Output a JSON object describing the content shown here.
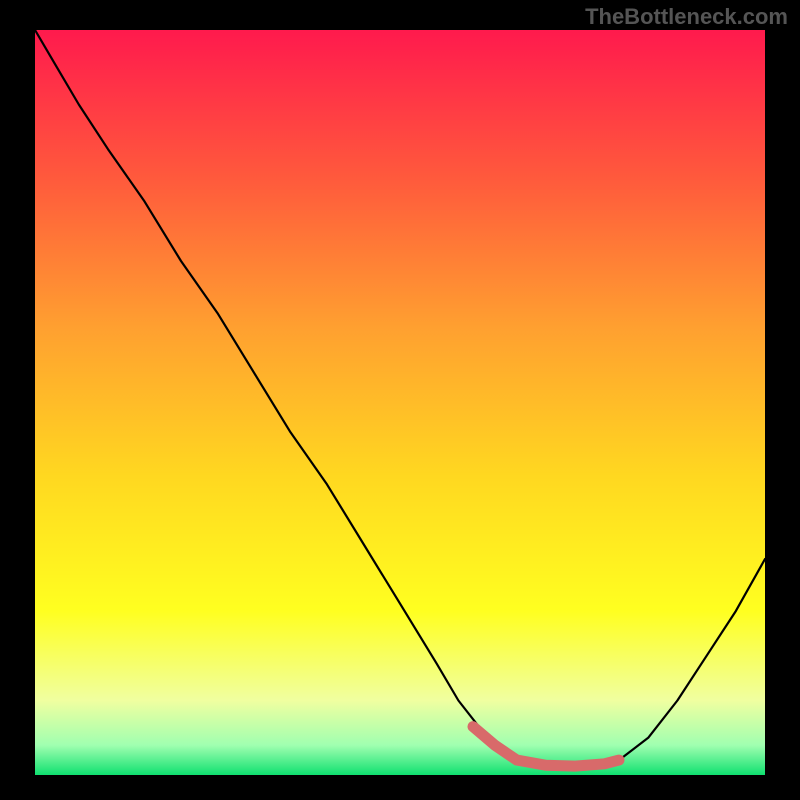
{
  "watermark": "TheBottleneck.com",
  "gradient_stops": [
    {
      "offset": "0%",
      "color": "#ff1a4d"
    },
    {
      "offset": "20%",
      "color": "#ff5a3c"
    },
    {
      "offset": "40%",
      "color": "#ffa030"
    },
    {
      "offset": "60%",
      "color": "#ffd820"
    },
    {
      "offset": "78%",
      "color": "#ffff20"
    },
    {
      "offset": "90%",
      "color": "#f0ffa0"
    },
    {
      "offset": "96%",
      "color": "#a0ffb0"
    },
    {
      "offset": "100%",
      "color": "#10e070"
    }
  ],
  "chart_data": {
    "type": "line",
    "title": "",
    "xlabel": "",
    "ylabel": "",
    "xlim": [
      0,
      100
    ],
    "ylim": [
      0,
      100
    ],
    "x": [
      0,
      3,
      6,
      10,
      15,
      20,
      25,
      30,
      35,
      40,
      45,
      50,
      55,
      58,
      62,
      66,
      70,
      74,
      78,
      80,
      84,
      88,
      92,
      96,
      100
    ],
    "y": [
      100,
      95,
      90,
      84,
      77,
      69,
      62,
      54,
      46,
      39,
      31,
      23,
      15,
      10,
      5,
      2,
      1.3,
      1.2,
      1.5,
      2,
      5,
      10,
      16,
      22,
      29
    ],
    "highlight_range": {
      "x_start": 60,
      "x_end": 80
    },
    "highlight_points": {
      "x": [
        60,
        63,
        66,
        70,
        74,
        78,
        80
      ],
      "y": [
        6.5,
        4,
        2,
        1.3,
        1.2,
        1.5,
        2
      ]
    }
  },
  "colors": {
    "curve": "#000000",
    "highlight": "#d86a6a",
    "background_frame": "#000000"
  }
}
